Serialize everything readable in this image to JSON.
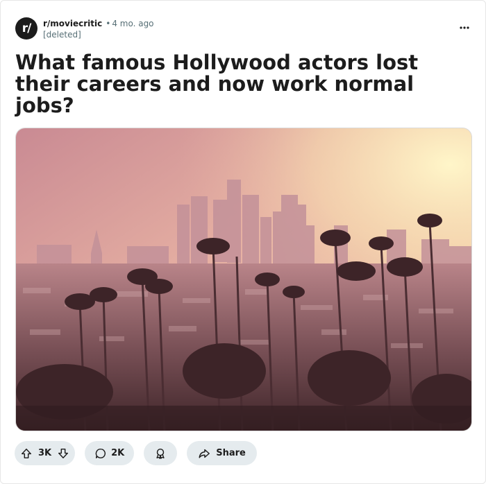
{
  "post": {
    "subreddit": "r/moviecritic",
    "separator": "•",
    "age": "4 mo. ago",
    "author": "[deleted]",
    "avatar_text": "r/",
    "more_icon": "ellipsis-icon",
    "title": "What famous Hollywood actors lost their careers and now work normal jobs?"
  },
  "actions": {
    "upvote_icon": "arrow-up-icon",
    "score": "3K",
    "downvote_icon": "arrow-down-icon",
    "comment_icon": "speech-bubble-icon",
    "comments": "2K",
    "award_icon": "award-ribbon-icon",
    "share_icon": "share-arrow-icon",
    "share_label": "Share"
  },
  "colors": {
    "pill_bg": "#e5ebee",
    "text": "#1c1c1c",
    "muted": "#576f76"
  }
}
